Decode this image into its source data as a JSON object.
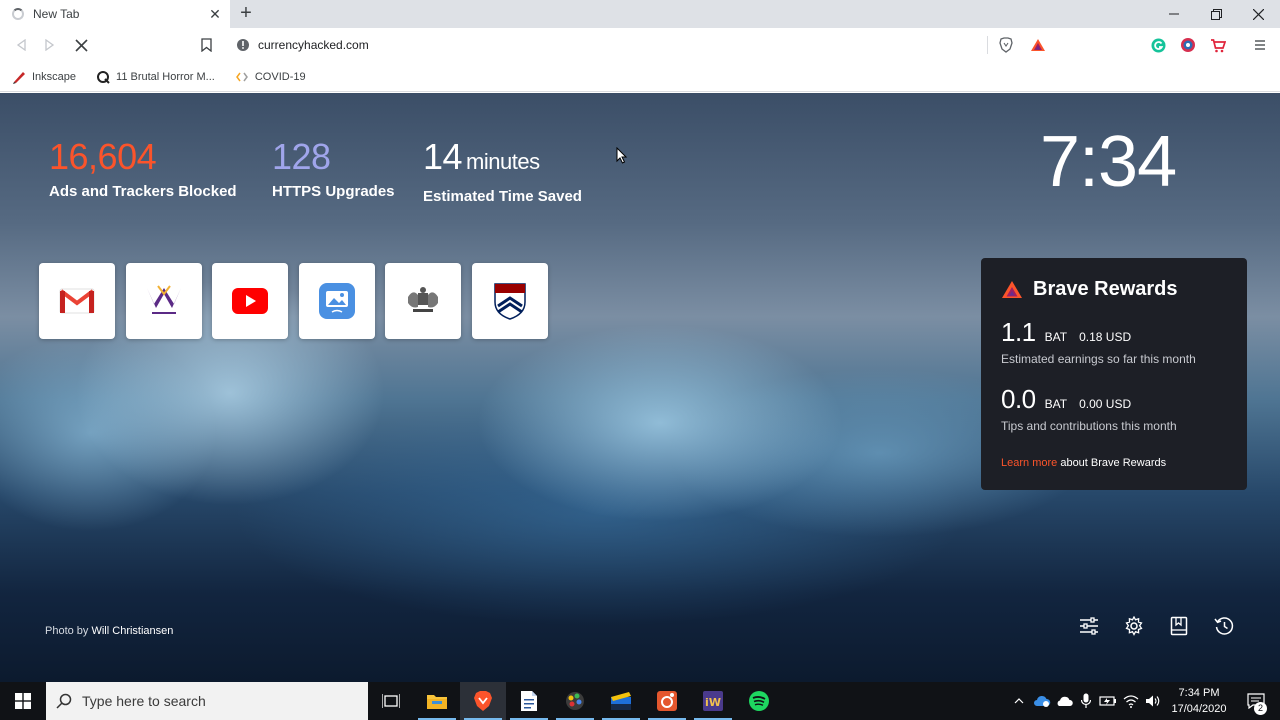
{
  "browser": {
    "tab": {
      "title": "New Tab"
    },
    "url": "currencyhacked.com",
    "bookmarks": [
      {
        "label": "Inkscape"
      },
      {
        "label": "11 Brutal Horror M..."
      },
      {
        "label": "COVID-19"
      }
    ]
  },
  "ntp": {
    "stats": {
      "ads": {
        "value": "16,604",
        "label": "Ads and Trackers Blocked",
        "color": "#fb542b"
      },
      "https": {
        "value": "128",
        "label": "HTTPS Upgrades",
        "color": "#a0a5eb"
      },
      "time": {
        "value": "14",
        "unit": "minutes",
        "label": "Estimated Time Saved"
      }
    },
    "clock": "7:34",
    "rewards": {
      "title": "Brave Rewards",
      "earnings": {
        "value": "1.1",
        "unit": "BAT",
        "usd": "0.18 USD",
        "desc": "Estimated earnings so far this month"
      },
      "tips": {
        "value": "0.0",
        "unit": "BAT",
        "usd": "0.00 USD",
        "desc": "Tips and contributions this month"
      },
      "link": {
        "accent": "Learn more",
        "rest": "about Brave Rewards"
      }
    },
    "photo_credit": {
      "prefix": "Photo by",
      "author": "Will Christiansen"
    }
  },
  "taskbar": {
    "search_placeholder": "Type here to search",
    "time": "7:34 PM",
    "date": "17/04/2020",
    "notification_count": "2"
  }
}
